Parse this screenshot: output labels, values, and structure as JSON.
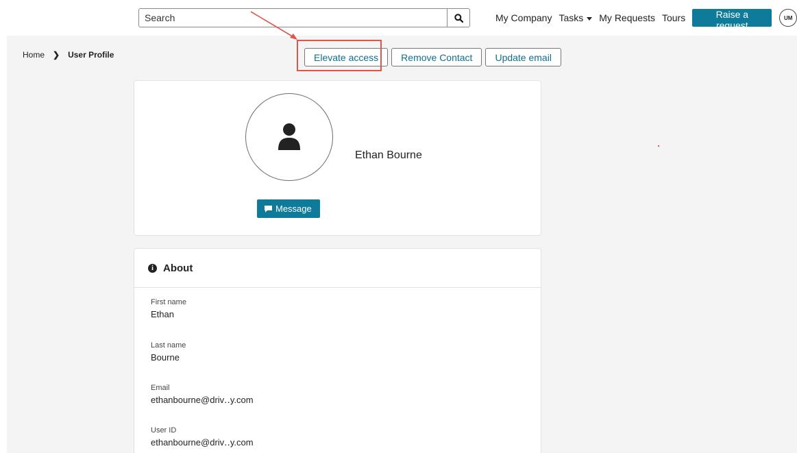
{
  "topbar": {
    "search_placeholder": "Search",
    "nav": {
      "my_company": "My Company",
      "tasks": "Tasks",
      "my_requests": "My Requests",
      "tours": "Tours"
    },
    "raise_request": "Raise a request",
    "avatar_initials": "UM"
  },
  "breadcrumb": {
    "home": "Home",
    "current": "User Profile"
  },
  "actions": {
    "elevate": "Elevate access",
    "remove": "Remove Contact",
    "update_email": "Update email"
  },
  "profile": {
    "name": "Ethan Bourne",
    "message_button": "Message"
  },
  "about": {
    "title": "About",
    "fields": [
      {
        "label": "First name",
        "value": "Ethan"
      },
      {
        "label": "Last name",
        "value": "Bourne"
      },
      {
        "label": "Email",
        "value": "ethanbourne@driv․․y.com"
      },
      {
        "label": "User ID",
        "value": "ethanbourne@driv․․y.com"
      }
    ]
  },
  "colors": {
    "accent": "#0e7b9a",
    "highlight": "#e0554a",
    "background": "#f4f4f4"
  }
}
